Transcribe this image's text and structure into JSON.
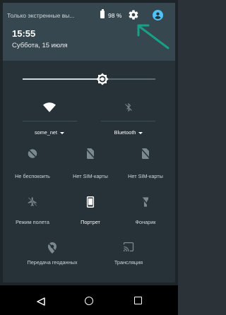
{
  "status": {
    "notice": "Только экстренные вы...",
    "battery": "98 %"
  },
  "header": {
    "time": "15:55",
    "date": "Суббота, 15 июля"
  },
  "brightness": {
    "level": 0.6
  },
  "tiles": {
    "wifi": "some_net",
    "bluetooth": "Bluetooth",
    "dnd": "Не беспокоить",
    "sim1": "Нет SIM-карты",
    "sim2": "Нет SIM-карты",
    "airplane": "Режим полета",
    "portrait": "Портрет",
    "flashlight": "Фонарик",
    "location": "Передача геоданных",
    "cast": "Трансляция"
  },
  "colors": {
    "header_bg": "#37474f",
    "panel_bg": "#263238",
    "accent": "#4fc3f7",
    "arrow": "#16a085"
  }
}
